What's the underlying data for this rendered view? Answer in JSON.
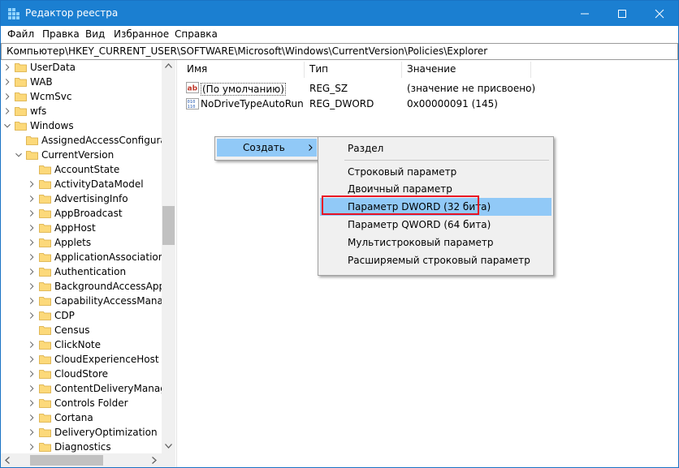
{
  "window": {
    "title": "Редактор реестра"
  },
  "menu": [
    "Файл",
    "Правка",
    "Вид",
    "Избранное",
    "Справка"
  ],
  "address": "Компьютер\\HKEY_CURRENT_USER\\SOFTWARE\\Microsoft\\Windows\\CurrentVersion\\Policies\\Explorer",
  "tree": [
    {
      "label": "UserData",
      "level": 0,
      "expanded": false
    },
    {
      "label": "WAB",
      "level": 0,
      "expanded": false
    },
    {
      "label": "WcmSvc",
      "level": 0,
      "expanded": false
    },
    {
      "label": "wfs",
      "level": 0,
      "expanded": false
    },
    {
      "label": "Windows",
      "level": 0,
      "expanded": true
    },
    {
      "label": "AssignedAccessConfiguratio",
      "level": 1,
      "expanded": false,
      "leaf": true
    },
    {
      "label": "CurrentVersion",
      "level": 1,
      "expanded": true
    },
    {
      "label": "AccountState",
      "level": 2,
      "expanded": false,
      "leaf": true
    },
    {
      "label": "ActivityDataModel",
      "level": 2,
      "expanded": false
    },
    {
      "label": "AdvertisingInfo",
      "level": 2,
      "expanded": false
    },
    {
      "label": "AppBroadcast",
      "level": 2,
      "expanded": false
    },
    {
      "label": "AppHost",
      "level": 2,
      "expanded": false
    },
    {
      "label": "Applets",
      "level": 2,
      "expanded": false
    },
    {
      "label": "ApplicationAssociationTo",
      "level": 2,
      "expanded": false
    },
    {
      "label": "Authentication",
      "level": 2,
      "expanded": false
    },
    {
      "label": "BackgroundAccessApplic",
      "level": 2,
      "expanded": false
    },
    {
      "label": "CapabilityAccessManage",
      "level": 2,
      "expanded": false
    },
    {
      "label": "CDP",
      "level": 2,
      "expanded": false
    },
    {
      "label": "Census",
      "level": 2,
      "expanded": false,
      "leaf": true
    },
    {
      "label": "ClickNote",
      "level": 2,
      "expanded": false
    },
    {
      "label": "CloudExperienceHost",
      "level": 2,
      "expanded": false
    },
    {
      "label": "CloudStore",
      "level": 2,
      "expanded": false
    },
    {
      "label": "ContentDeliveryManager",
      "level": 2,
      "expanded": false
    },
    {
      "label": "Controls Folder",
      "level": 2,
      "expanded": false
    },
    {
      "label": "Cortana",
      "level": 2,
      "expanded": false
    },
    {
      "label": "DeliveryOptimization",
      "level": 2,
      "expanded": false
    },
    {
      "label": "Diagnostics",
      "level": 2,
      "expanded": false
    }
  ],
  "list": {
    "headers": {
      "name": "Имя",
      "type": "Тип",
      "value": "Значение"
    },
    "rows": [
      {
        "icon": "string-value-icon",
        "name": "(По умолчанию)",
        "type": "REG_SZ",
        "value": "(значение не присвоено)"
      },
      {
        "icon": "binary-value-icon",
        "name": "NoDriveTypeAutoRun",
        "type": "REG_DWORD",
        "value": "0x00000091 (145)"
      }
    ]
  },
  "context_menu": {
    "item": "Создать"
  },
  "submenu": {
    "items": [
      "Раздел",
      "Строковый параметр",
      "Двоичный параметр",
      "Параметр DWORD (32 бита)",
      "Параметр QWORD (64 бита)",
      "Мультистроковый параметр",
      "Расширяемый строковый параметр"
    ],
    "highlighted": "Параметр DWORD (32 бита)"
  },
  "colors": {
    "titlebar": "#1b7fd1",
    "highlight": "#91c9f7",
    "annotation": "#e81123",
    "folder": "#fcd97a"
  }
}
